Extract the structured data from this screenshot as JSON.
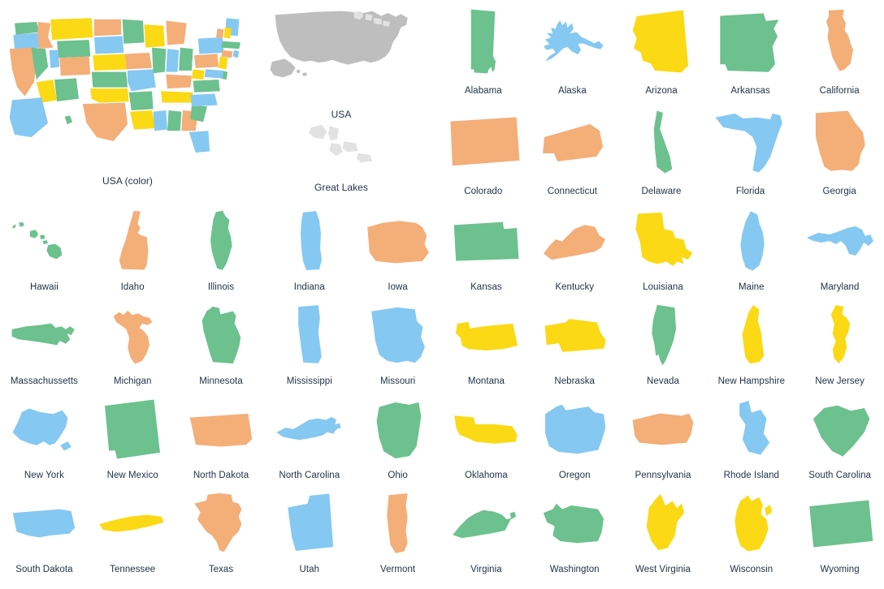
{
  "palette": {
    "green": "#6cc18e",
    "orange": "#f4ae78",
    "yellow": "#fbd914",
    "blue": "#85c8f2",
    "gray": "#bebebe",
    "light_gray": "#e2e2e2",
    "text": "#1f3145",
    "background": "#ffffff"
  },
  "overview": {
    "usa_color_label": "USA (color)",
    "usa_label": "USA",
    "great_lakes_label": "Great Lakes"
  },
  "top_states": [
    {
      "name": "Alabama",
      "color": "#6cc18e"
    },
    {
      "name": "Alaska",
      "color": "#85c8f2"
    },
    {
      "name": "Arizona",
      "color": "#fbd914"
    },
    {
      "name": "Arkansas",
      "color": "#6cc18e"
    },
    {
      "name": "California",
      "color": "#f4ae78"
    },
    {
      "name": "Colorado",
      "color": "#f4ae78"
    },
    {
      "name": "Connecticut",
      "color": "#f4ae78"
    },
    {
      "name": "Delaware",
      "color": "#6cc18e"
    },
    {
      "name": "Florida",
      "color": "#85c8f2"
    },
    {
      "name": "Georgia",
      "color": "#f4ae78"
    }
  ],
  "states": [
    {
      "name": "Hawaii",
      "color": "#6cc18e"
    },
    {
      "name": "Idaho",
      "color": "#f4ae78"
    },
    {
      "name": "Illinois",
      "color": "#6cc18e"
    },
    {
      "name": "Indiana",
      "color": "#85c8f2"
    },
    {
      "name": "Iowa",
      "color": "#f4ae78"
    },
    {
      "name": "Kansas",
      "color": "#6cc18e"
    },
    {
      "name": "Kentucky",
      "color": "#f4ae78"
    },
    {
      "name": "Louisiana",
      "color": "#fbd914"
    },
    {
      "name": "Maine",
      "color": "#85c8f2"
    },
    {
      "name": "Maryland",
      "color": "#85c8f2"
    },
    {
      "name": "Massachussetts",
      "color": "#6cc18e"
    },
    {
      "name": "Michigan",
      "color": "#f4ae78"
    },
    {
      "name": "Minnesota",
      "color": "#6cc18e"
    },
    {
      "name": "Mississippi",
      "color": "#85c8f2"
    },
    {
      "name": "Missouri",
      "color": "#85c8f2"
    },
    {
      "name": "Montana",
      "color": "#fbd914"
    },
    {
      "name": "Nebraska",
      "color": "#fbd914"
    },
    {
      "name": "Nevada",
      "color": "#6cc18e"
    },
    {
      "name": "New Hampshire",
      "color": "#fbd914"
    },
    {
      "name": "New Jersey",
      "color": "#fbd914"
    },
    {
      "name": "New York",
      "color": "#85c8f2"
    },
    {
      "name": "New Mexico",
      "color": "#6cc18e"
    },
    {
      "name": "North Dakota",
      "color": "#f4ae78"
    },
    {
      "name": "North Carolina",
      "color": "#85c8f2"
    },
    {
      "name": "Ohio",
      "color": "#6cc18e"
    },
    {
      "name": "Oklahoma",
      "color": "#fbd914"
    },
    {
      "name": "Oregon",
      "color": "#85c8f2"
    },
    {
      "name": "Pennsylvania",
      "color": "#f4ae78"
    },
    {
      "name": "Rhode Island",
      "color": "#85c8f2"
    },
    {
      "name": "South Carolina",
      "color": "#6cc18e"
    },
    {
      "name": "South Dakota",
      "color": "#85c8f2"
    },
    {
      "name": "Tennessee",
      "color": "#fbd914"
    },
    {
      "name": "Texas",
      "color": "#f4ae78"
    },
    {
      "name": "Utah",
      "color": "#85c8f2"
    },
    {
      "name": "Vermont",
      "color": "#f4ae78"
    },
    {
      "name": "Virginia",
      "color": "#6cc18e"
    },
    {
      "name": "Washington",
      "color": "#6cc18e"
    },
    {
      "name": "West Virginia",
      "color": "#fbd914"
    },
    {
      "name": "Wisconsin",
      "color": "#fbd914"
    },
    {
      "name": "Wyoming",
      "color": "#6cc18e"
    }
  ],
  "usa_color_map_states": [
    {
      "code": "WA",
      "color": "#6cc18e"
    },
    {
      "code": "OR",
      "color": "#85c8f2"
    },
    {
      "code": "CA",
      "color": "#f4ae78"
    },
    {
      "code": "NV",
      "color": "#6cc18e"
    },
    {
      "code": "ID",
      "color": "#f4ae78"
    },
    {
      "code": "MT",
      "color": "#fbd914"
    },
    {
      "code": "WY",
      "color": "#6cc18e"
    },
    {
      "code": "UT",
      "color": "#85c8f2"
    },
    {
      "code": "AZ",
      "color": "#fbd914"
    },
    {
      "code": "NM",
      "color": "#6cc18e"
    },
    {
      "code": "CO",
      "color": "#f4ae78"
    },
    {
      "code": "ND",
      "color": "#f4ae78"
    },
    {
      "code": "SD",
      "color": "#85c8f2"
    },
    {
      "code": "NE",
      "color": "#fbd914"
    },
    {
      "code": "KS",
      "color": "#6cc18e"
    },
    {
      "code": "OK",
      "color": "#fbd914"
    },
    {
      "code": "TX",
      "color": "#f4ae78"
    },
    {
      "code": "MN",
      "color": "#6cc18e"
    },
    {
      "code": "IA",
      "color": "#f4ae78"
    },
    {
      "code": "MO",
      "color": "#85c8f2"
    },
    {
      "code": "AR",
      "color": "#6cc18e"
    },
    {
      "code": "LA",
      "color": "#fbd914"
    },
    {
      "code": "WI",
      "color": "#fbd914"
    },
    {
      "code": "IL",
      "color": "#6cc18e"
    },
    {
      "code": "MS",
      "color": "#85c8f2"
    },
    {
      "code": "AL",
      "color": "#6cc18e"
    },
    {
      "code": "MI",
      "color": "#f4ae78"
    },
    {
      "code": "IN",
      "color": "#85c8f2"
    },
    {
      "code": "KY",
      "color": "#f4ae78"
    },
    {
      "code": "TN",
      "color": "#fbd914"
    },
    {
      "code": "OH",
      "color": "#6cc18e"
    },
    {
      "code": "GA",
      "color": "#f4ae78"
    },
    {
      "code": "FL",
      "color": "#85c8f2"
    },
    {
      "code": "SC",
      "color": "#6cc18e"
    },
    {
      "code": "NC",
      "color": "#85c8f2"
    },
    {
      "code": "VA",
      "color": "#6cc18e"
    },
    {
      "code": "WV",
      "color": "#fbd914"
    },
    {
      "code": "PA",
      "color": "#f4ae78"
    },
    {
      "code": "NY",
      "color": "#85c8f2"
    },
    {
      "code": "ME",
      "color": "#85c8f2"
    },
    {
      "code": "VT",
      "color": "#f4ae78"
    },
    {
      "code": "NH",
      "color": "#fbd914"
    },
    {
      "code": "MA",
      "color": "#6cc18e"
    },
    {
      "code": "CT",
      "color": "#f4ae78"
    },
    {
      "code": "RI",
      "color": "#85c8f2"
    },
    {
      "code": "NJ",
      "color": "#fbd914"
    },
    {
      "code": "DE",
      "color": "#6cc18e"
    },
    {
      "code": "MD",
      "color": "#85c8f2"
    },
    {
      "code": "AK",
      "color": "#85c8f2"
    },
    {
      "code": "HI",
      "color": "#6cc18e"
    }
  ]
}
